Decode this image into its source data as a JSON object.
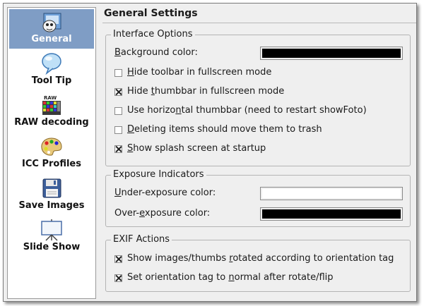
{
  "sidebar": {
    "items": [
      {
        "label": "General",
        "icon": "general-icon",
        "selected": true
      },
      {
        "label": "Tool Tip",
        "icon": "tooltip-icon"
      },
      {
        "label": "RAW decoding",
        "icon": "raw-icon",
        "icon_text": "RAW"
      },
      {
        "label": "ICC Profiles",
        "icon": "palette-icon"
      },
      {
        "label": "Save Images",
        "icon": "floppy-icon"
      },
      {
        "label": "Slide Show",
        "icon": "projector-icon"
      }
    ]
  },
  "page_title": "General Settings",
  "interface": {
    "title": "Interface Options",
    "bg_label": {
      "pre": "",
      "key": "B",
      "post": "ackground color:"
    },
    "bg_color": "#000000",
    "options": [
      {
        "pre": "",
        "key": "H",
        "post": "ide toolbar in fullscreen mode",
        "checked": false
      },
      {
        "pre": "Hide ",
        "key": "t",
        "post": "humbbar in fullscreen mode",
        "checked": true
      },
      {
        "pre": "Use horizo",
        "key": "n",
        "post": "tal thumbbar (need to restart showFoto)",
        "checked": false
      },
      {
        "pre": "",
        "key": "D",
        "post": "eleting items should move them to trash",
        "checked": false
      },
      {
        "pre": "",
        "key": "S",
        "post": "how splash screen at startup",
        "checked": true
      }
    ]
  },
  "exposure": {
    "title": "Exposure Indicators",
    "under_label": {
      "pre": "",
      "key": "U",
      "post": "nder-exposure color:"
    },
    "under_color": "#ffffff",
    "over_label": {
      "pre": "Over-",
      "key": "e",
      "post": "xposure color:"
    },
    "over_color": "#000000"
  },
  "exif": {
    "title": "EXIF Actions",
    "options": [
      {
        "pre": "Show images/thumbs ",
        "key": "r",
        "post": "otated according to orientation tag",
        "checked": true
      },
      {
        "pre": "Set orientation tag to ",
        "key": "n",
        "post": "ormal after rotate/flip",
        "checked": true
      }
    ]
  }
}
